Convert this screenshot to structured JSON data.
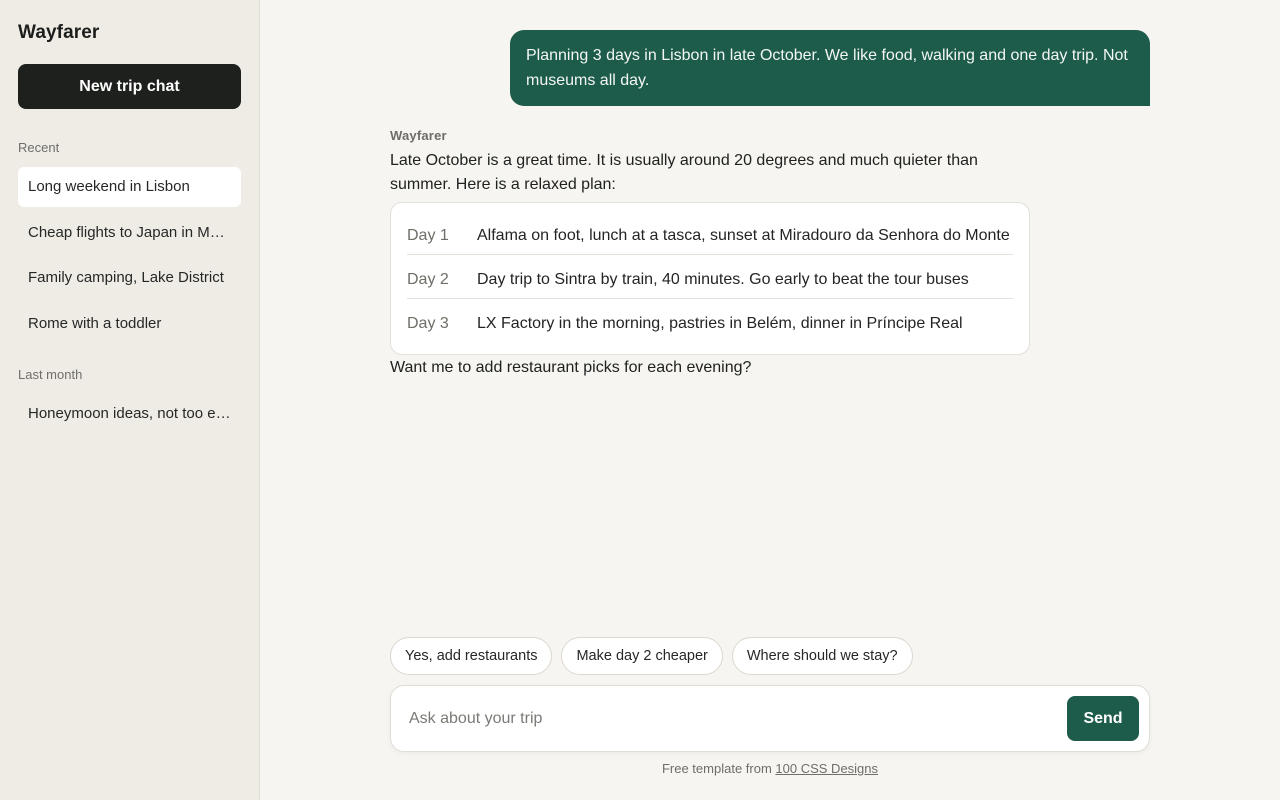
{
  "sidebar": {
    "brand": "Wayfarer",
    "new_chat_label": "New trip chat",
    "sections": [
      {
        "label": "Recent",
        "items": [
          {
            "label": "Long weekend in Lisbon",
            "active": true
          },
          {
            "label": "Cheap flights to Japan in March"
          },
          {
            "label": "Family camping, Lake District"
          },
          {
            "label": "Rome with a toddler"
          }
        ]
      },
      {
        "label": "Last month",
        "items": [
          {
            "label": "Honeymoon ideas, not too expensive"
          }
        ]
      }
    ]
  },
  "conversation": {
    "user_message": "Planning 3 days in Lisbon in late October. We like food, walking and one day trip. Not museums all day.",
    "assistant_name": "Wayfarer",
    "assistant_intro": "Late October is a great time. It is usually around 20 degrees and much quieter than summer. Here is a relaxed plan:",
    "plan": [
      {
        "day": "Day 1",
        "desc": "Alfama on foot, lunch at a tasca, sunset at Miradouro da Senhora do Monte"
      },
      {
        "day": "Day 2",
        "desc": "Day trip to Sintra by train, 40 minutes. Go early to beat the tour buses"
      },
      {
        "day": "Day 3",
        "desc": "LX Factory in the morning, pastries in Belém, dinner in Príncipe Real"
      }
    ],
    "assistant_followup": "Want me to add restaurant picks for each evening?"
  },
  "suggestions": [
    "Yes, add restaurants",
    "Make day 2 cheaper",
    "Where should we stay?"
  ],
  "composer": {
    "placeholder": "Ask about your trip",
    "send_label": "Send"
  },
  "footer": {
    "prefix": "Free template from ",
    "link": "100 CSS Designs"
  },
  "colors": {
    "accent": "#1d5c4b",
    "sidebar_bg": "#efece6",
    "page_bg": "#f6f5f1",
    "dark_button": "#1e201e"
  }
}
